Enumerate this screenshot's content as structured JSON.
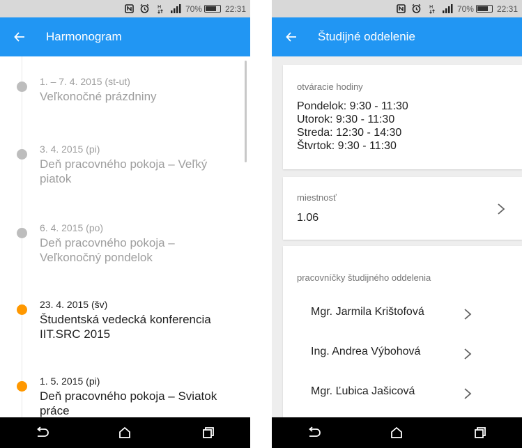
{
  "status_bar": {
    "battery": "70%",
    "time": "22:31"
  },
  "left": {
    "title": "Harmonogram",
    "events": [
      {
        "date": "1. – 7. 4. 2015  (st-ut)",
        "title": "Veľkonočné prázdniny",
        "state": "past"
      },
      {
        "date": "3. 4. 2015  (pi)",
        "title": "Deň pracovného pokoja – Veľký piatok",
        "state": "past"
      },
      {
        "date": "6. 4. 2015 (po)",
        "title": "Deň pracovného pokoja – Veľkonočný pondelok",
        "state": "past"
      },
      {
        "date": "23. 4. 2015  (šv)",
        "title": "Študentská vedecká konferencia IIT.SRC 2015",
        "state": "upcoming"
      },
      {
        "date": "1. 5. 2015  (pi)",
        "title": "Deň pracovného pokoja – Sviatok práce",
        "state": "upcoming"
      }
    ]
  },
  "right": {
    "title": "Študijné oddelenie",
    "hours_label": "otváracie hodiny",
    "hours": [
      "Pondelok: 9:30 - 11:30",
      "Utorok: 9:30 - 11:30",
      "Streda: 12:30 - 14:30",
      "Štvrtok: 9:30 - 11:30"
    ],
    "room_label": "miestnosť",
    "room": "1.06",
    "staff_label": "pracovníčky študijného oddelenia",
    "staff": [
      "Mgr. Jarmila Krištofová",
      "Ing. Andrea Výbohová",
      "Mgr. Ľubica Jašicová"
    ]
  },
  "colors": {
    "accent": "#2196f3",
    "upcoming_dot": "#ff9800",
    "past_dot": "#bdbdbd"
  }
}
